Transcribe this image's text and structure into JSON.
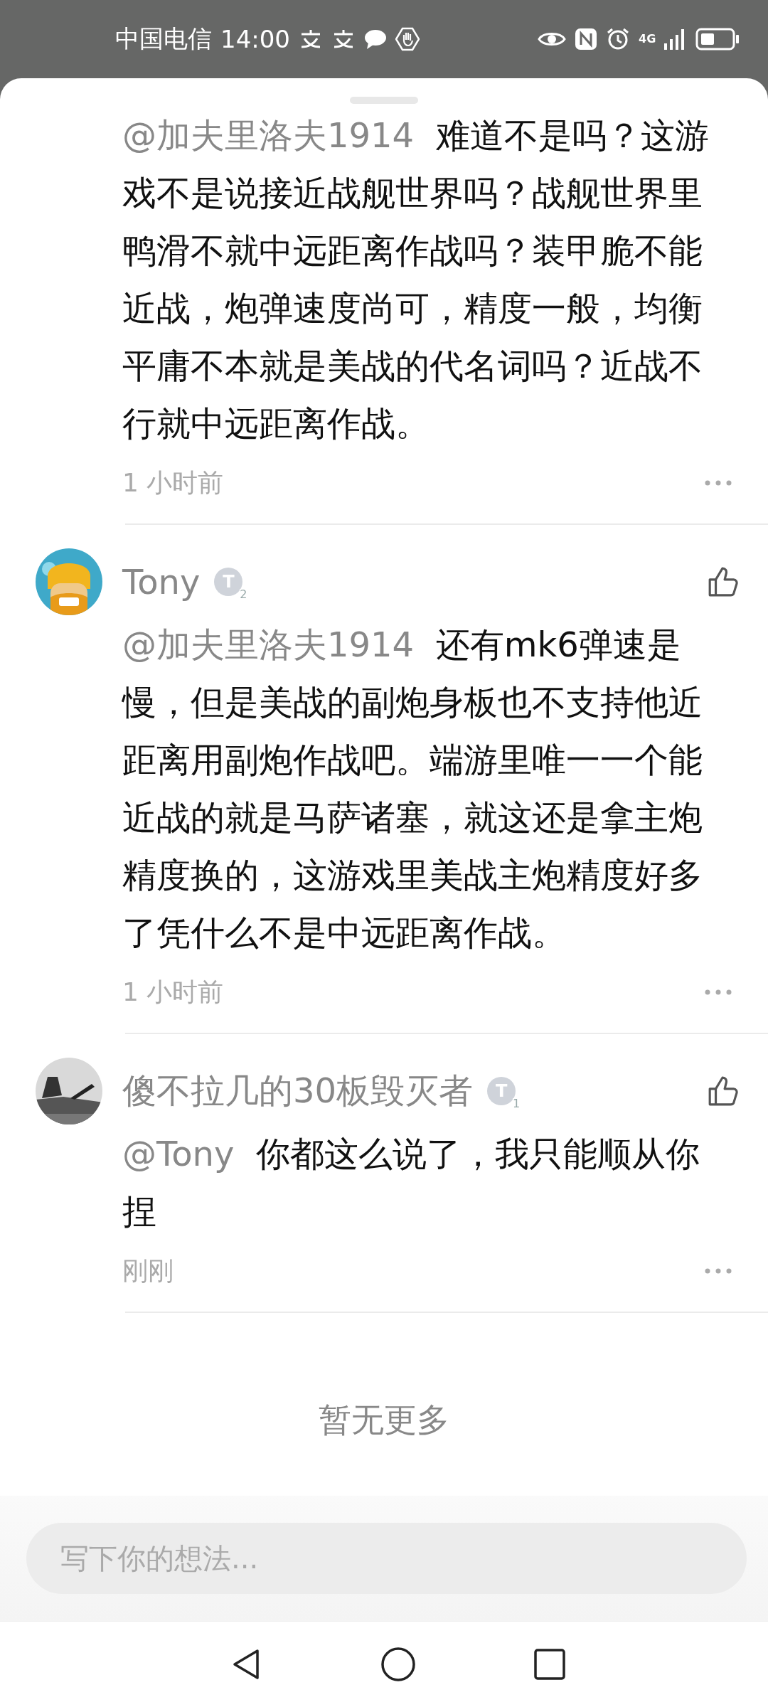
{
  "status_bar": {
    "carrier": "中国电信",
    "time": "14:00",
    "network": "4G"
  },
  "comments": [
    {
      "mention": "@加夫里洛夫1914",
      "text": "难道不是吗？这游戏不是说接近战舰世界吗？战舰世界里鸭滑不就中远距离作战吗？装甲脆不能近战，炮弹速度尚可，精度一般，均衡平庸不本就是美战的代名词吗？近战不行就中远距离作战。",
      "time": "1 小时前"
    },
    {
      "author": "Tony",
      "badge": "T",
      "badge_level": "2",
      "mention": "@加夫里洛夫1914",
      "text": "还有mk6弹速是慢，但是美战的副炮身板也不支持他近距离用副炮作战吧。端游里唯一一个能近战的就是马萨诸塞，就这还是拿主炮精度换的，这游戏里美战主炮精度好多了凭什么不是中远距离作战。",
      "time": "1 小时前"
    },
    {
      "author": "傻不拉几的30板毁灭者",
      "badge": "T",
      "badge_level": "1",
      "mention": "@Tony",
      "text": "你都这么说了，我只能顺从你捏",
      "time": "刚刚"
    }
  ],
  "end_note": "暂无更多",
  "composer": {
    "placeholder": "写下你的想法..."
  }
}
